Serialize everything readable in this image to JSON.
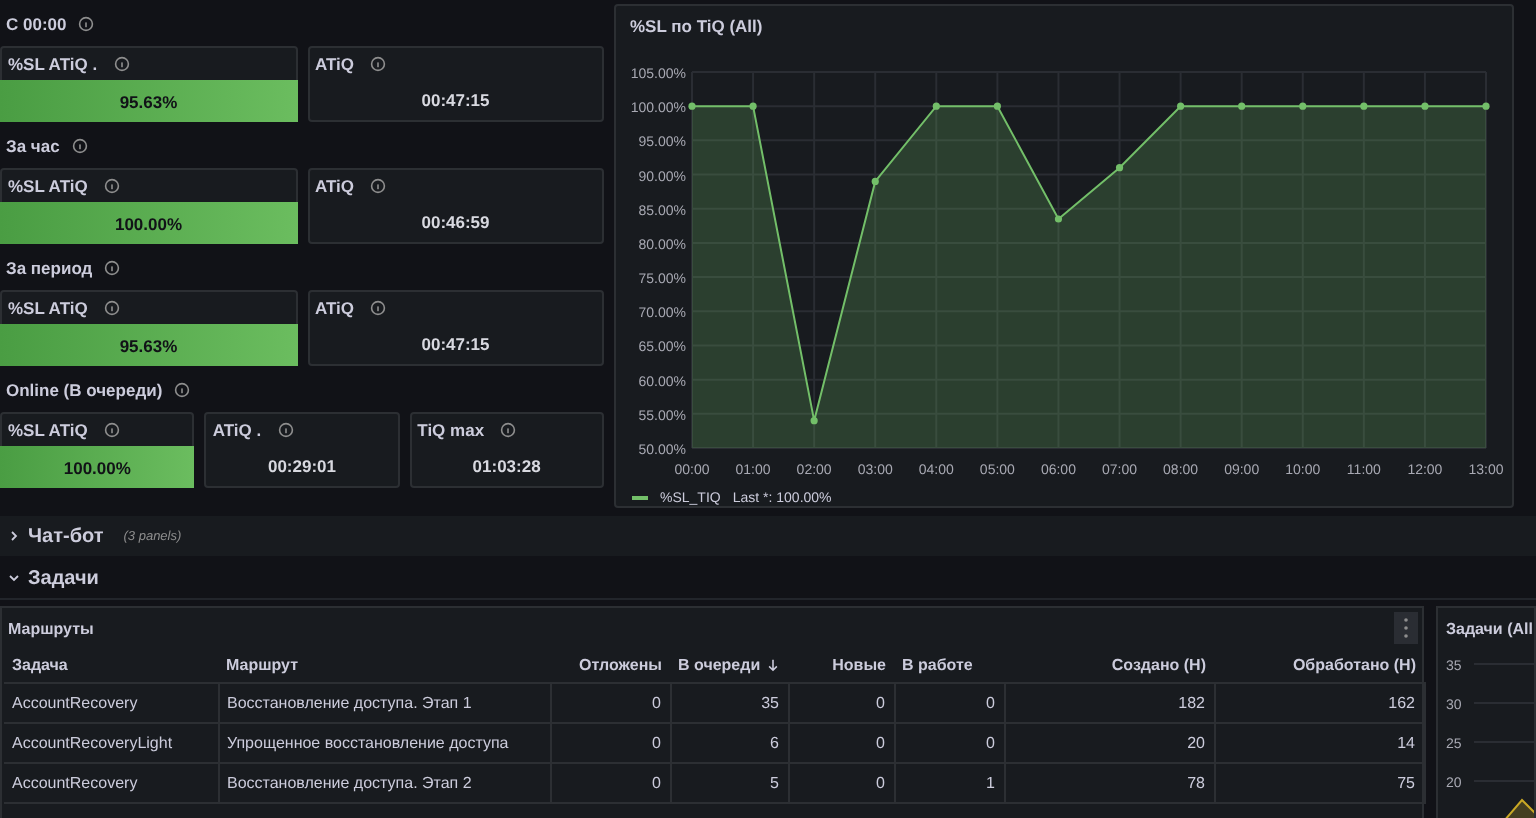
{
  "stat_groups": [
    {
      "title": "С 00:00",
      "panels": [
        {
          "kind": "percent",
          "title": "%SL ATiQ .",
          "value": "95.63%"
        },
        {
          "kind": "time",
          "title": "ATiQ",
          "value": "00:47:15"
        }
      ]
    },
    {
      "title": "За час",
      "panels": [
        {
          "kind": "percent",
          "title": "%SL ATiQ",
          "value": "100.00%"
        },
        {
          "kind": "time",
          "title": "ATiQ",
          "value": "00:46:59"
        }
      ]
    },
    {
      "title": "За период",
      "panels": [
        {
          "kind": "percent",
          "title": "%SL ATiQ",
          "value": "95.63%"
        },
        {
          "kind": "time",
          "title": "ATiQ",
          "value": "00:47:15"
        }
      ]
    },
    {
      "title": "Online (В очереди)",
      "panels": [
        {
          "kind": "percent",
          "title": "%SL ATiQ",
          "value": "100.00%"
        },
        {
          "kind": "time",
          "title": "ATiQ .",
          "value": "00:29:01"
        },
        {
          "kind": "time",
          "title": "TiQ max",
          "value": "01:03:28"
        }
      ]
    }
  ],
  "sl_chart": {
    "title": "%SL по TiQ (All)",
    "legend": "Last *: 100.00%",
    "chart_data": {
      "type": "area",
      "categories": [
        "00:00",
        "01:00",
        "02:00",
        "03:00",
        "04:00",
        "05:00",
        "06:00",
        "07:00",
        "08:00",
        "09:00",
        "10:00",
        "11:00",
        "12:00",
        "13:00"
      ],
      "series": [
        {
          "name": "%SL_TIQ",
          "color": "#73bf69",
          "values": [
            100,
            100,
            54,
            89,
            100,
            100,
            83.5,
            91,
            100,
            100,
            100,
            100,
            100,
            100
          ]
        }
      ],
      "ylim": [
        50,
        105
      ],
      "grid": true,
      "yticks": [
        {
          "value": 50,
          "label": "50.00%"
        },
        {
          "value": 55,
          "label": "55.00%"
        },
        {
          "value": 60,
          "label": "60.00%"
        },
        {
          "value": 65,
          "label": "65.00%"
        },
        {
          "value": 70,
          "label": "70.00%"
        },
        {
          "value": 75,
          "label": "75.00%"
        },
        {
          "value": 80,
          "label": "80.00%"
        },
        {
          "value": 85,
          "label": "85.00%"
        },
        {
          "value": 90,
          "label": "90.00%"
        },
        {
          "value": 95,
          "label": "95.00%"
        },
        {
          "value": 100,
          "label": "100.00%"
        },
        {
          "value": 105,
          "label": "105.00%"
        }
      ]
    }
  },
  "rows": [
    {
      "title": "Чат-бот",
      "note": "(3 panels)",
      "expanded": false
    },
    {
      "title": "Задачи",
      "expanded": true
    }
  ],
  "table": {
    "title": "Маршруты",
    "columns": [
      {
        "label": "Задача",
        "sorted": false
      },
      {
        "label": "Маршрут",
        "sorted": false
      },
      {
        "label": "Отложены",
        "sorted": false
      },
      {
        "label": "В очереди",
        "sorted": true
      },
      {
        "label": "Новые",
        "sorted": false
      },
      {
        "label": "В работе",
        "sorted": false
      },
      {
        "label": "Создано (Н)",
        "sorted": false
      },
      {
        "label": "Обработано (Н)",
        "sorted": false
      }
    ],
    "rows": [
      [
        "AccountRecovery",
        "Восстановление доступа. Этап 1",
        "0",
        "35",
        "0",
        "0",
        "182",
        "162"
      ],
      [
        "AccountRecoveryLight",
        "Упрощенное восстановление доступа",
        "0",
        "6",
        "0",
        "0",
        "20",
        "14"
      ],
      [
        "AccountRecovery",
        "Восстановление доступа. Этап 2",
        "0",
        "5",
        "0",
        "1",
        "78",
        "75"
      ]
    ]
  },
  "tasks_chart": {
    "title": "Задачи (All",
    "axis_labels": [
      "35",
      "30",
      "25",
      "20"
    ]
  }
}
